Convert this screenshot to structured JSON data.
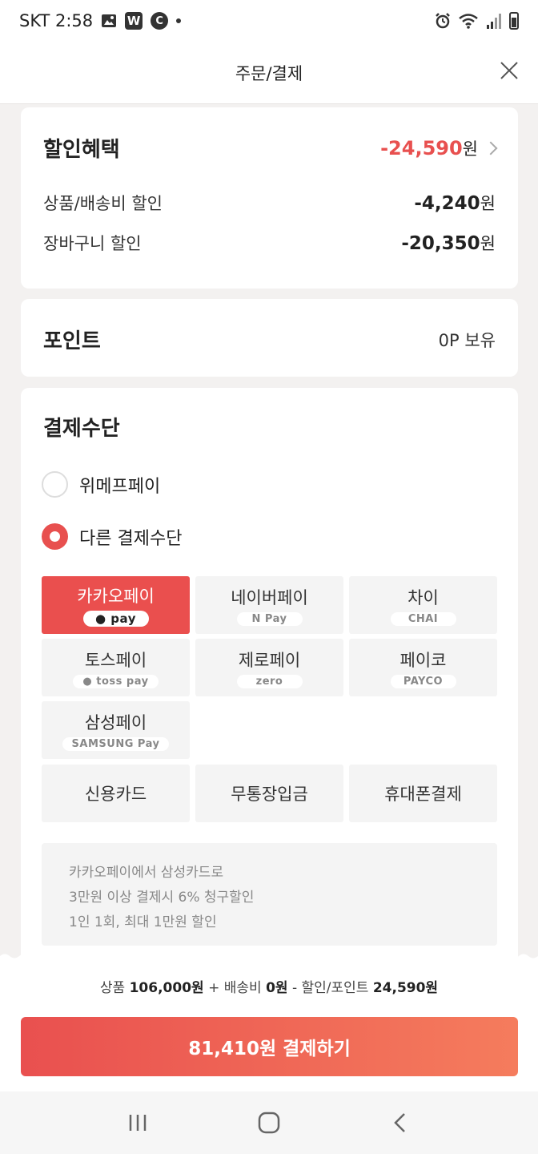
{
  "status_bar": {
    "carrier_time": "SKT 2:58",
    "icon_w": "W",
    "icon_c": "C"
  },
  "header": {
    "title": "주문/결제"
  },
  "discount": {
    "title": "할인혜택",
    "total_amount": "-24,590",
    "won": "원",
    "items": [
      {
        "label": "상품/배송비 할인",
        "amount": "-4,240",
        "won": "원"
      },
      {
        "label": "장바구니 할인",
        "amount": "-20,350",
        "won": "원"
      }
    ]
  },
  "points": {
    "title": "포인트",
    "value": "0P 보유"
  },
  "payment": {
    "title": "결제수단",
    "options": [
      {
        "label": "위메프페이",
        "selected": false
      },
      {
        "label": "다른 결제수단",
        "selected": true
      }
    ],
    "methods": [
      {
        "label": "카카오페이",
        "badge": "● pay",
        "active": true
      },
      {
        "label": "네이버페이",
        "badge": "N Pay",
        "active": false
      },
      {
        "label": "차이",
        "badge": "CHAI",
        "active": false
      },
      {
        "label": "토스페이",
        "badge": "● toss pay",
        "active": false
      },
      {
        "label": "제로페이",
        "badge": "zero",
        "active": false
      },
      {
        "label": "페이코",
        "badge": "PAYCO",
        "active": false
      },
      {
        "label": "삼성페이",
        "badge": "SAMSUNG Pay",
        "active": false
      },
      {
        "label": "신용카드",
        "badge": "",
        "active": false
      },
      {
        "label": "무통장입금",
        "badge": "",
        "active": false
      },
      {
        "label": "휴대폰결제",
        "badge": "",
        "active": false
      }
    ],
    "info_lines": [
      "카카오페이에서 삼성카드로",
      "3만원 이상 결제시 6% 청구할인",
      "1인 1회, 최대 1만원 할인"
    ]
  },
  "summary": {
    "product_label": "상품",
    "product_amount": "106,000원",
    "plus": "+",
    "shipping_label": "배송비",
    "shipping_amount": "0원",
    "minus": "-",
    "discount_label": "할인/포인트",
    "discount_amount": "24,590원"
  },
  "pay_button": {
    "label": "81,410원 결제하기"
  },
  "colors": {
    "accent": "#e8504f",
    "accent_end": "#f57c5d",
    "tile_bg": "#f4f4f4"
  }
}
